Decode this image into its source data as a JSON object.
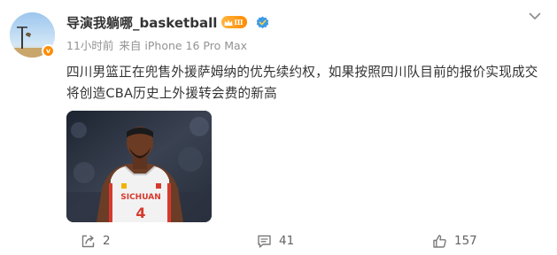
{
  "post": {
    "author": {
      "name": "导演我躺哪_basketball",
      "level_badge": "III",
      "avatar_badge": "v"
    },
    "meta": {
      "time": "11小时前",
      "source": "来自 iPhone 16 Pro Max"
    },
    "text_line1": "四川男篮正在兜售外援萨姆纳的优先续约权，如果按照四川队目前的报价实现成交",
    "text_line2": "将创造CBA历史上外援转会费的新高",
    "image": {
      "jersey_text": "SICHUAN",
      "jersey_number": "4"
    },
    "actions": {
      "share_count": "2",
      "comment_count": "41",
      "like_count": "157"
    }
  },
  "colors": {
    "text": "#333333",
    "meta": "#939393",
    "action": "#636363",
    "badge_orange": "#ff8a00",
    "verify_blue": "#3d9be8",
    "jersey_red": "#d63a2e"
  },
  "icons": [
    "more-icon",
    "crown-icon",
    "verified-icon",
    "share-icon",
    "comment-icon",
    "like-icon"
  ]
}
